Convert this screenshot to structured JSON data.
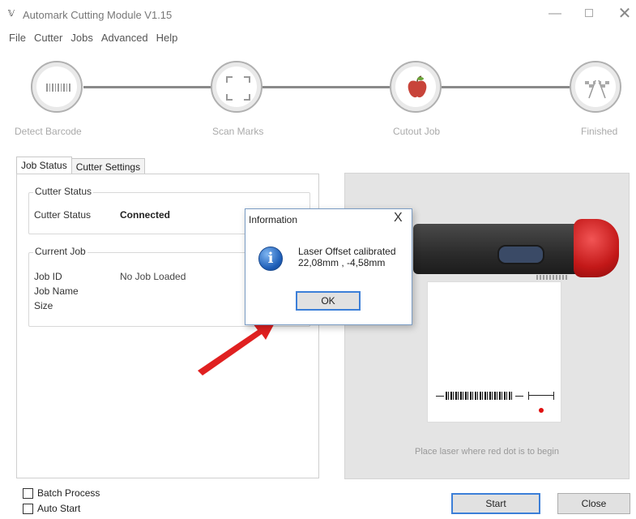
{
  "window": {
    "app_icon": "𝕍",
    "title": "Automark Cutting Module V1.15",
    "minimize": "—",
    "close": "✕"
  },
  "menu": [
    "File",
    "Cutter",
    "Jobs",
    "Advanced",
    "Help"
  ],
  "steps": [
    {
      "label": "Detect Barcode",
      "icon": "barcode-icon"
    },
    {
      "label": "Scan Marks",
      "icon": "scan-frame-icon"
    },
    {
      "label": "Cutout Job",
      "icon": "apple-icon"
    },
    {
      "label": "Finished",
      "icon": "checkered-flags-icon"
    }
  ],
  "tabs": [
    "Job Status",
    "Cutter Settings"
  ],
  "cutter_status": {
    "group_title": "Cutter Status",
    "label": "Cutter Status",
    "value": "Connected"
  },
  "current_job": {
    "group_title": "Current Job",
    "job_id_label": "Job ID",
    "job_id_value": "No Job Loaded",
    "job_name_label": "Job Name",
    "size_label": "Size"
  },
  "options": {
    "batch_process": "Batch Process",
    "auto_start": "Auto Start"
  },
  "preview": {
    "caption": "Place laser where red dot is to begin"
  },
  "buttons": {
    "start": "Start",
    "close": "Close"
  },
  "dialog": {
    "title": "Information",
    "close": "X",
    "icon_glyph": "i",
    "message_line1": "Laser Offset calibrated",
    "message_line2": "22,08mm , -4,58mm",
    "ok": "OK"
  },
  "colors": {
    "accent_blue": "#3c7fd8",
    "cutter_red": "#c31818",
    "arrow_red": "#e02020"
  }
}
